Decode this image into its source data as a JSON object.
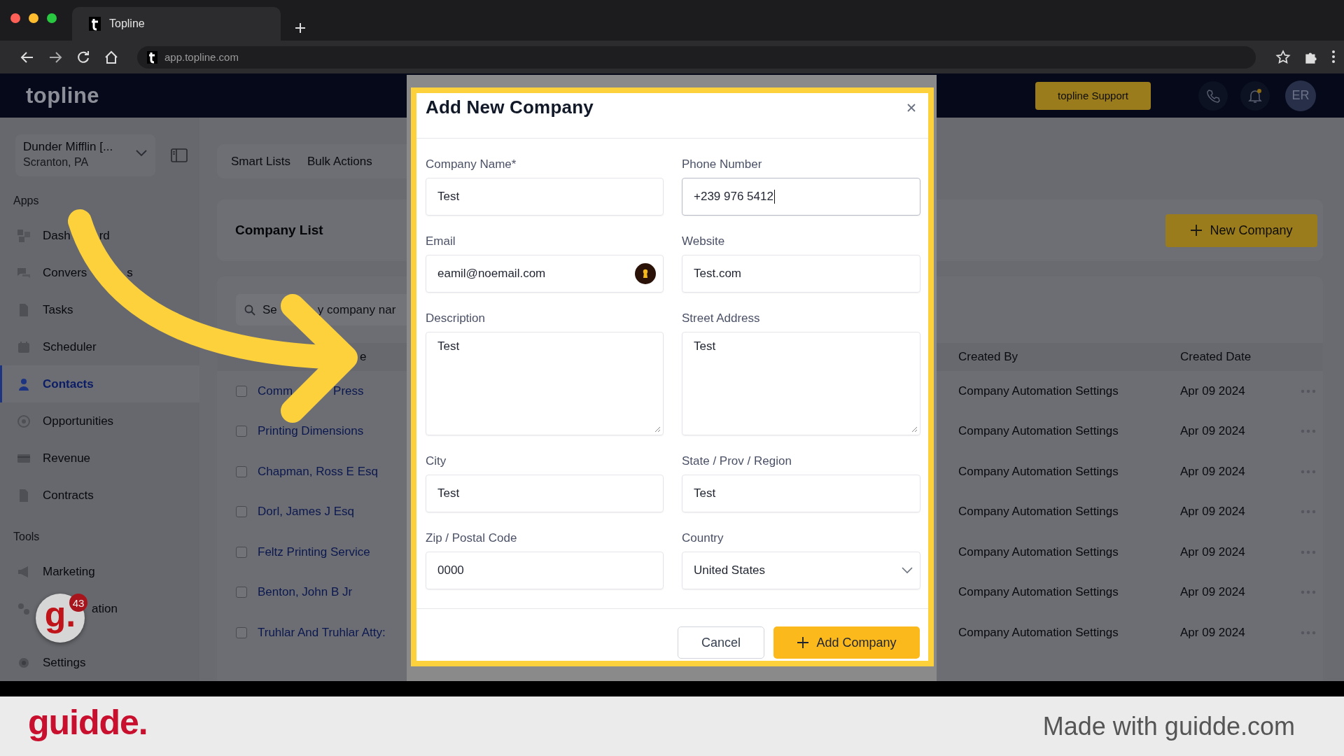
{
  "browser": {
    "tab_title": "Topline",
    "url": "app.topline.com"
  },
  "header": {
    "logo": "topline",
    "support_button": "topline Support",
    "avatar": "ER"
  },
  "sidebar": {
    "workspace": {
      "name": "Dunder Mifflin [...",
      "location": "Scranton, PA"
    },
    "sections": [
      {
        "title": "Apps",
        "items": [
          {
            "label": "Dash",
            "label_end": "rd",
            "selected": false
          },
          {
            "label": "Convers",
            "label_end": "s",
            "selected": false
          },
          {
            "label": "Tasks",
            "selected": false
          },
          {
            "label": "Scheduler",
            "selected": false
          },
          {
            "label": "Contacts",
            "selected": true
          },
          {
            "label": "Opportunities",
            "selected": false
          },
          {
            "label": "Revenue",
            "selected": false
          },
          {
            "label": "Contracts",
            "selected": false
          }
        ]
      },
      {
        "title": "Tools",
        "items": [
          {
            "label": "Marketing",
            "selected": false
          },
          {
            "label": "ation",
            "selected": false
          }
        ]
      }
    ],
    "bottom_item": {
      "label": "Settings",
      "selected": false
    }
  },
  "tabs": [
    {
      "label": "Smart Lists"
    },
    {
      "label": "Bulk Actions"
    }
  ],
  "company_list": {
    "title": "Company List",
    "new_button": "New Company"
  },
  "search": {
    "placeholder": "Se",
    "placeholder_end": "y company nar"
  },
  "table": {
    "columns": [
      "e",
      "Created By",
      "Created Date"
    ],
    "rows": [
      {
        "name": "Comm",
        "name_end": "Press",
        "created_by": "Company Automation Settings",
        "created_date": "Apr 09 2024",
        "checked": false
      },
      {
        "name": "Printing Dimensions",
        "created_by": "Company Automation Settings",
        "created_date": "Apr 09 2024",
        "checked": false
      },
      {
        "name": "Chapman, Ross E Esq",
        "created_by": "Company Automation Settings",
        "created_date": "Apr 09 2024",
        "checked": false
      },
      {
        "name": "Dorl, James J Esq",
        "created_by": "Company Automation Settings",
        "created_date": "Apr 09 2024",
        "checked": false
      },
      {
        "name": "Feltz Printing Service",
        "created_by": "Company Automation Settings",
        "created_date": "Apr 09 2024",
        "checked": false
      },
      {
        "name": "Benton, John B Jr",
        "created_by": "Company Automation Settings",
        "created_date": "Apr 09 2024",
        "checked": false
      },
      {
        "name": "Truhlar And Truhlar Atty:",
        "created_by": "Company Automation Settings",
        "created_date": "Apr 09 2024",
        "checked": false
      }
    ]
  },
  "modal": {
    "title": "Add New Company",
    "fields": [
      {
        "label": "Company Name*",
        "value": "Test",
        "kind": "input",
        "focused": false,
        "autofill": false
      },
      {
        "label": "Phone Number",
        "value": "+239 976 5412",
        "kind": "input",
        "focused": true,
        "autofill": false
      },
      {
        "label": "Email",
        "value": "eamil@noemail.com",
        "kind": "input",
        "focused": false,
        "autofill": true
      },
      {
        "label": "Website",
        "value": "Test.com",
        "kind": "input",
        "focused": false,
        "autofill": false
      },
      {
        "label": "Description",
        "value": "Test",
        "kind": "textarea",
        "focused": false,
        "autofill": false
      },
      {
        "label": "Street Address",
        "value": "Test",
        "kind": "textarea",
        "focused": false,
        "autofill": false
      },
      {
        "label": "City",
        "value": "Test",
        "kind": "input",
        "focused": false,
        "autofill": false
      },
      {
        "label": "State / Prov / Region",
        "value": "Test",
        "kind": "input",
        "focused": false,
        "autofill": false
      },
      {
        "label": "Zip / Postal Code",
        "value": "0000",
        "kind": "input",
        "focused": false,
        "autofill": false
      },
      {
        "label": "Country",
        "value": "United States",
        "kind": "select",
        "focused": false,
        "autofill": false
      }
    ],
    "buttons": [
      {
        "label": "Cancel",
        "kind": "secondary"
      },
      {
        "label": "Add Company",
        "kind": "primary"
      }
    ]
  },
  "guidde_launcher": {
    "label": "g.",
    "count": "43"
  },
  "footer": {
    "logo": "guidde.",
    "tagline": "Made with guidde.com"
  }
}
